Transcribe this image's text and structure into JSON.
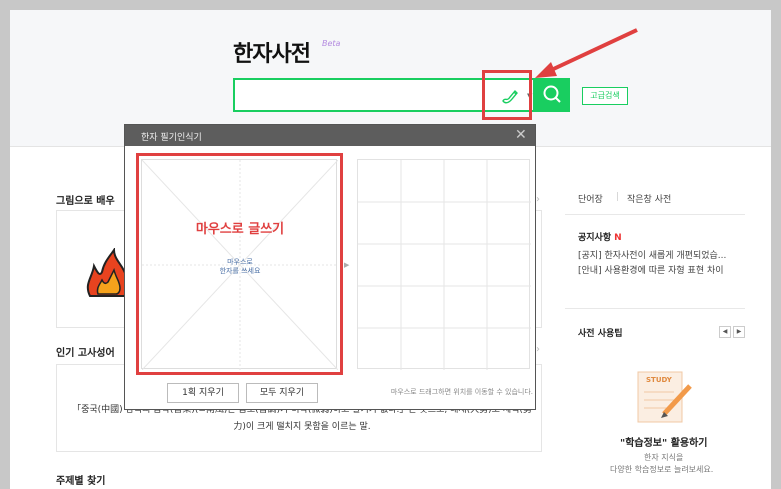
{
  "header": {
    "logo": "한자사전",
    "beta": "Beta",
    "search_placeholder": "",
    "advanced_search": "고급검색"
  },
  "left": {
    "picture_learning_title": "그림으로 배우",
    "proverb_title": "인기 고사성어",
    "proverb_text": "「중국(中國) 남쪽의 음악(音樂)(=南風)은 음조(音調)가 미약(微弱)하고 활기가 없다.」는 뜻으로, 대세(大勢)로 세력(勢力)이 크게 떨치지 못함을 이르는 말.",
    "theme_title": "주제별 찾기"
  },
  "right": {
    "tab_wordbook": "단어장",
    "tab_small": "작은창 사전",
    "notice_title": "공지사항",
    "notice_badge": "N",
    "notice_1": "[공지] 한자사전이 새롭게 개편되었습...",
    "notice_2": "[안내] 사용환경에 따른 자형 표현 차이",
    "tips_title": "사전 사용팁",
    "pager_prev": "◀",
    "pager_next": "▶",
    "study_label": "STUDY",
    "tip_heading": "\"학습정보\" 활용하기",
    "tip_line1": "한자 지식을",
    "tip_line2": "다양한 학습정보로 늘려보세요."
  },
  "modal": {
    "title": "한자 필기인식기",
    "close": "✕",
    "mouse_write": "마우스로 글쓰기",
    "hint_line1": "마우스로",
    "hint_line2": "한자를 쓰세요",
    "undo_one": "1획 지우기",
    "clear_all": "모두 지우기",
    "note": "마우스로 드래그하면 위치를 이동할 수 있습니다."
  },
  "colors": {
    "accent": "#19ce60",
    "highlight": "#e04040",
    "modal_header": "#5d5d5d"
  }
}
